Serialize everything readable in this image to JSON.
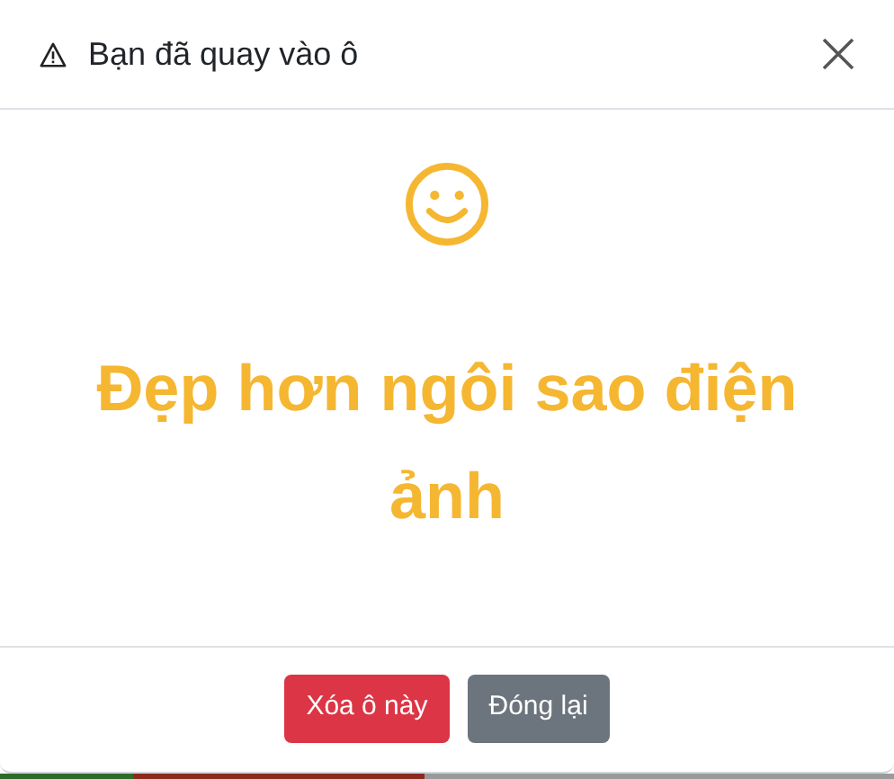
{
  "modal": {
    "title": "Bạn đã quay vào ô",
    "message": "Đẹp hơn ngôi sao điện ảnh"
  },
  "buttons": [
    {
      "label": "Xóa ô này",
      "kind": "danger"
    },
    {
      "label": "Đóng lại",
      "kind": "secondary"
    }
  ]
}
